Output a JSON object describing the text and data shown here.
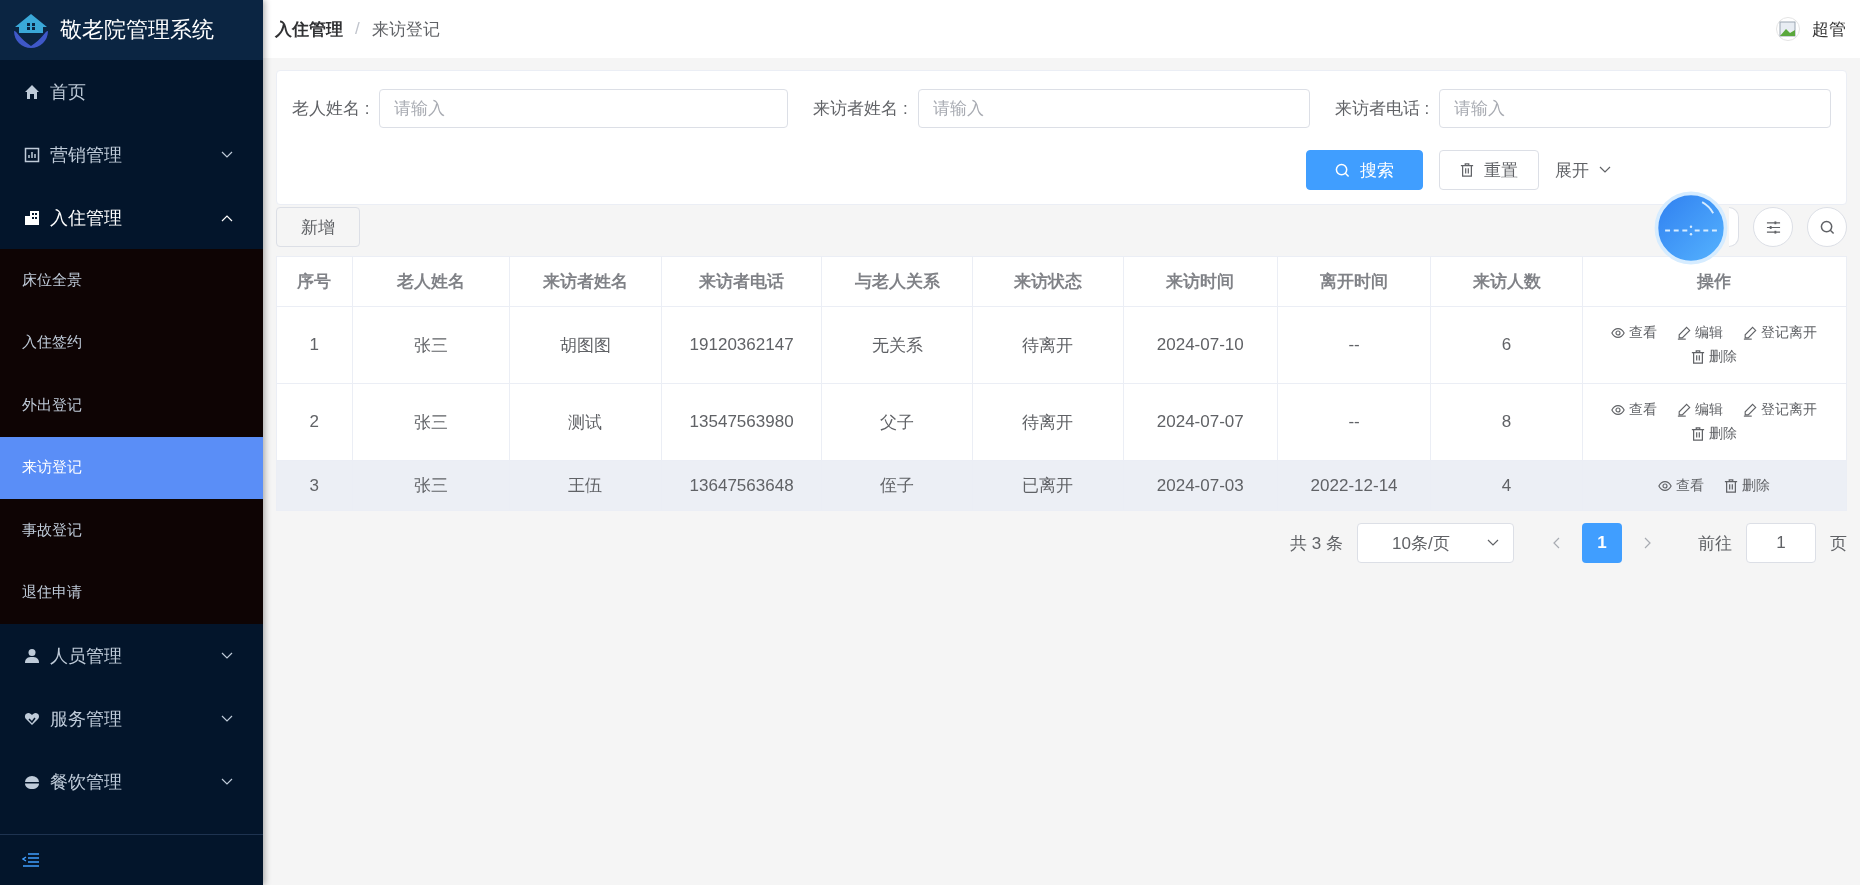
{
  "sidebar": {
    "title": "敬老院管理系统",
    "items": [
      {
        "label": "首页",
        "kind": "link"
      },
      {
        "label": "营销管理",
        "kind": "group",
        "expanded": false
      },
      {
        "label": "入住管理",
        "kind": "group",
        "expanded": true,
        "children": [
          {
            "label": "床位全景",
            "selected": false
          },
          {
            "label": "入住签约",
            "selected": false
          },
          {
            "label": "外出登记",
            "selected": false
          },
          {
            "label": "来访登记",
            "selected": true
          },
          {
            "label": "事故登记",
            "selected": false
          },
          {
            "label": "退住申请",
            "selected": false
          }
        ]
      },
      {
        "label": "人员管理",
        "kind": "group",
        "expanded": false
      },
      {
        "label": "服务管理",
        "kind": "group",
        "expanded": false
      },
      {
        "label": "餐饮管理",
        "kind": "group",
        "expanded": false
      }
    ]
  },
  "header": {
    "breadcrumb": [
      "入住管理",
      "来访登记"
    ],
    "separator": "/",
    "user": "超管"
  },
  "search": {
    "fields": [
      {
        "label": "老人姓名 :",
        "placeholder": "请输入"
      },
      {
        "label": "来访者姓名 :",
        "placeholder": "请输入"
      },
      {
        "label": "来访者电话 :",
        "placeholder": "请输入"
      }
    ],
    "buttons": [
      {
        "label": "搜索",
        "kind": "search"
      },
      {
        "label": "重置",
        "kind": "reset"
      },
      {
        "label": "展开",
        "kind": "expand"
      }
    ]
  },
  "toolbar": {
    "add": "新增"
  },
  "table": {
    "columns": [
      "序号",
      "老人姓名",
      "来访者姓名",
      "来访者电话",
      "与老人关系",
      "来访状态",
      "来访时间",
      "离开时间",
      "来访人数",
      "操作"
    ],
    "rows": [
      {
        "highlighted": false,
        "cells": [
          "1",
          "张三",
          "胡图图",
          "19120362147",
          "无关系",
          "待离开",
          "2024-07-10",
          "--",
          "6"
        ],
        "actions": [
          {
            "label": "查看",
            "kind": "view"
          },
          {
            "label": "编辑",
            "kind": "edit"
          },
          {
            "label": "登记离开",
            "kind": "edit"
          },
          {
            "label": "删除",
            "kind": "delete"
          }
        ]
      },
      {
        "highlighted": false,
        "cells": [
          "2",
          "张三",
          "测试",
          "13547563980",
          "父子",
          "待离开",
          "2024-07-07",
          "--",
          "8"
        ],
        "actions": [
          {
            "label": "查看",
            "kind": "view"
          },
          {
            "label": "编辑",
            "kind": "edit"
          },
          {
            "label": "登记离开",
            "kind": "edit"
          },
          {
            "label": "删除",
            "kind": "delete"
          }
        ]
      },
      {
        "highlighted": true,
        "cells": [
          "3",
          "张三",
          "王伍",
          "13647563648",
          "侄子",
          "已离开",
          "2024-07-03",
          "2022-12-14",
          "4"
        ],
        "actions": [
          {
            "label": "查看",
            "kind": "view"
          },
          {
            "label": "删除",
            "kind": "delete"
          }
        ]
      }
    ]
  },
  "pagination": {
    "total": "共 3 条",
    "page_size": "10条/页",
    "pages": [
      {
        "label": "1",
        "selected": true
      }
    ],
    "goto_label": "前往",
    "goto_value": "1",
    "goto_suffix": "页"
  }
}
